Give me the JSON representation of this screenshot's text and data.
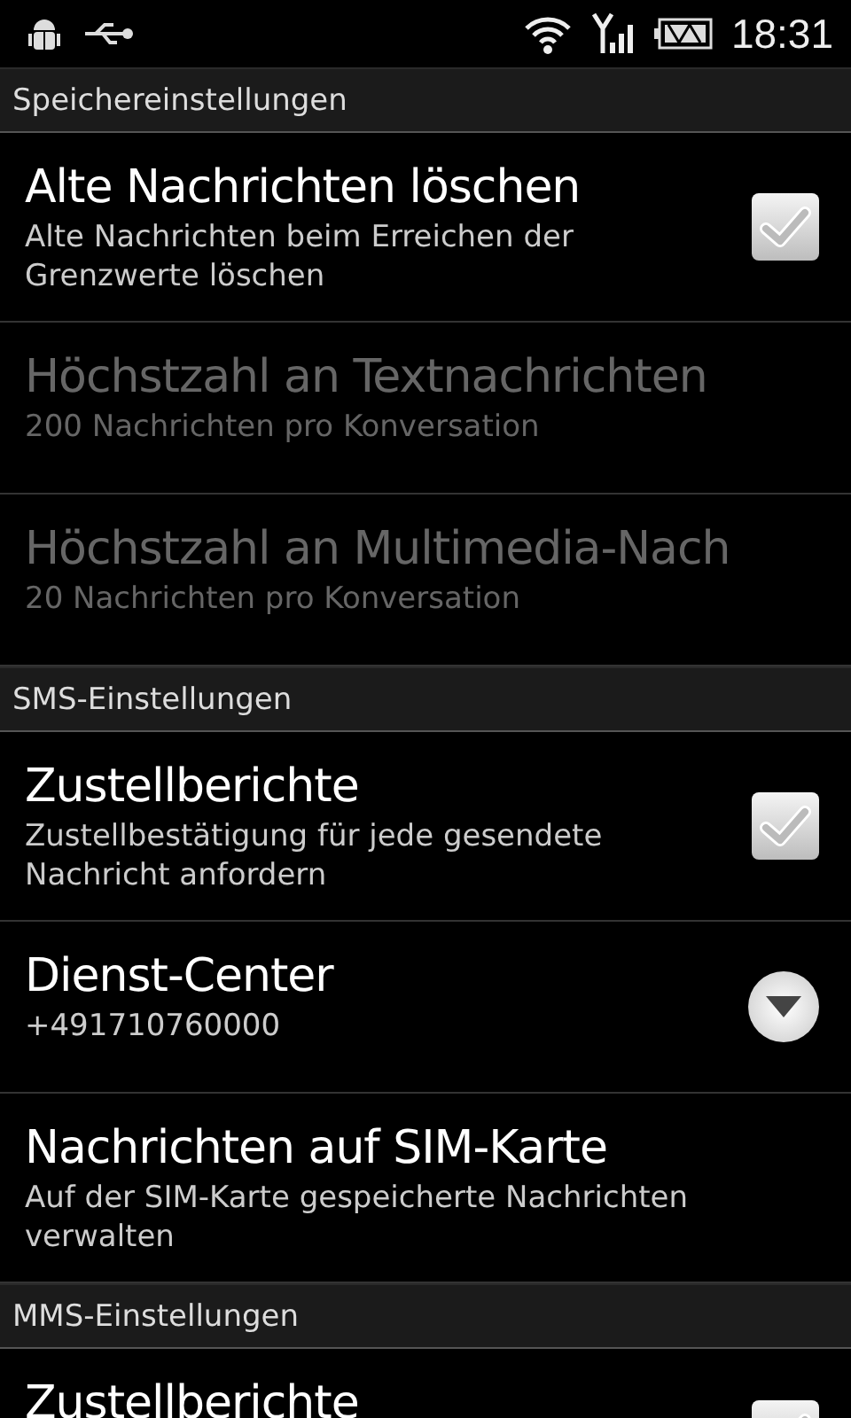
{
  "status_bar": {
    "time": "18:31"
  },
  "sections": [
    {
      "title": "Speichereinstellungen",
      "items": [
        {
          "kind": "checkbox",
          "title": "Alte Nachrichten löschen",
          "summary": "Alte Nachrichten beim Erreichen der Grenzwerte löschen",
          "checked": true,
          "disabled": false
        },
        {
          "kind": "plain",
          "title": "Höchstzahl an Textnachrichten",
          "summary": "200 Nachrichten pro Konversation",
          "disabled": true
        },
        {
          "kind": "plain",
          "title": "Höchstzahl an Multimedia-Nach",
          "summary": "20 Nachrichten pro Konversation",
          "disabled": true
        }
      ]
    },
    {
      "title": "SMS-Einstellungen",
      "items": [
        {
          "kind": "checkbox",
          "title": "Zustellberichte",
          "summary": "Zustellbestätigung für jede gesendete Nachricht anfordern",
          "checked": true,
          "disabled": false
        },
        {
          "kind": "dropdown",
          "title": "Dienst-Center",
          "summary": "+491710760000",
          "disabled": false
        },
        {
          "kind": "plain",
          "title": "Nachrichten auf SIM-Karte",
          "summary": "Auf der SIM-Karte gespeicherte Nachrichten verwalten",
          "disabled": false
        }
      ]
    },
    {
      "title": "MMS-Einstellungen",
      "items": [
        {
          "kind": "checkbox",
          "title": "Zustellberichte",
          "checked": true,
          "disabled": false
        }
      ]
    }
  ]
}
